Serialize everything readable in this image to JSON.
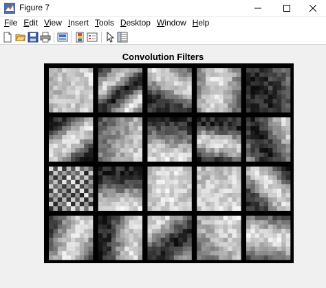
{
  "window": {
    "title": "Figure 7",
    "app_icon": "matlab-icon",
    "controls": [
      "minimize-icon",
      "maximize-icon",
      "close-icon"
    ]
  },
  "menubar": {
    "items": [
      {
        "label": "File",
        "mnemonic": "F",
        "rest": "ile"
      },
      {
        "label": "Edit",
        "mnemonic": "E",
        "rest": "dit"
      },
      {
        "label": "View",
        "mnemonic": "V",
        "rest": "iew"
      },
      {
        "label": "Insert",
        "mnemonic": "I",
        "rest": "nsert"
      },
      {
        "label": "Tools",
        "mnemonic": "T",
        "rest": "ools"
      },
      {
        "label": "Desktop",
        "mnemonic": "D",
        "rest": "esktop"
      },
      {
        "label": "Window",
        "mnemonic": "W",
        "rest": "indow"
      },
      {
        "label": "Help",
        "mnemonic": "H",
        "rest": "elp"
      }
    ]
  },
  "toolbar": {
    "icons": [
      "new-figure-icon",
      "open-file-icon",
      "save-icon",
      "print-icon",
      "link-plot-icon",
      "colorbar-icon",
      "legend-icon",
      "pointer-icon",
      "property-inspector-icon"
    ]
  },
  "figure": {
    "title": "Convolution Filters",
    "grid": {
      "rows": 4,
      "cols": 5
    }
  }
}
